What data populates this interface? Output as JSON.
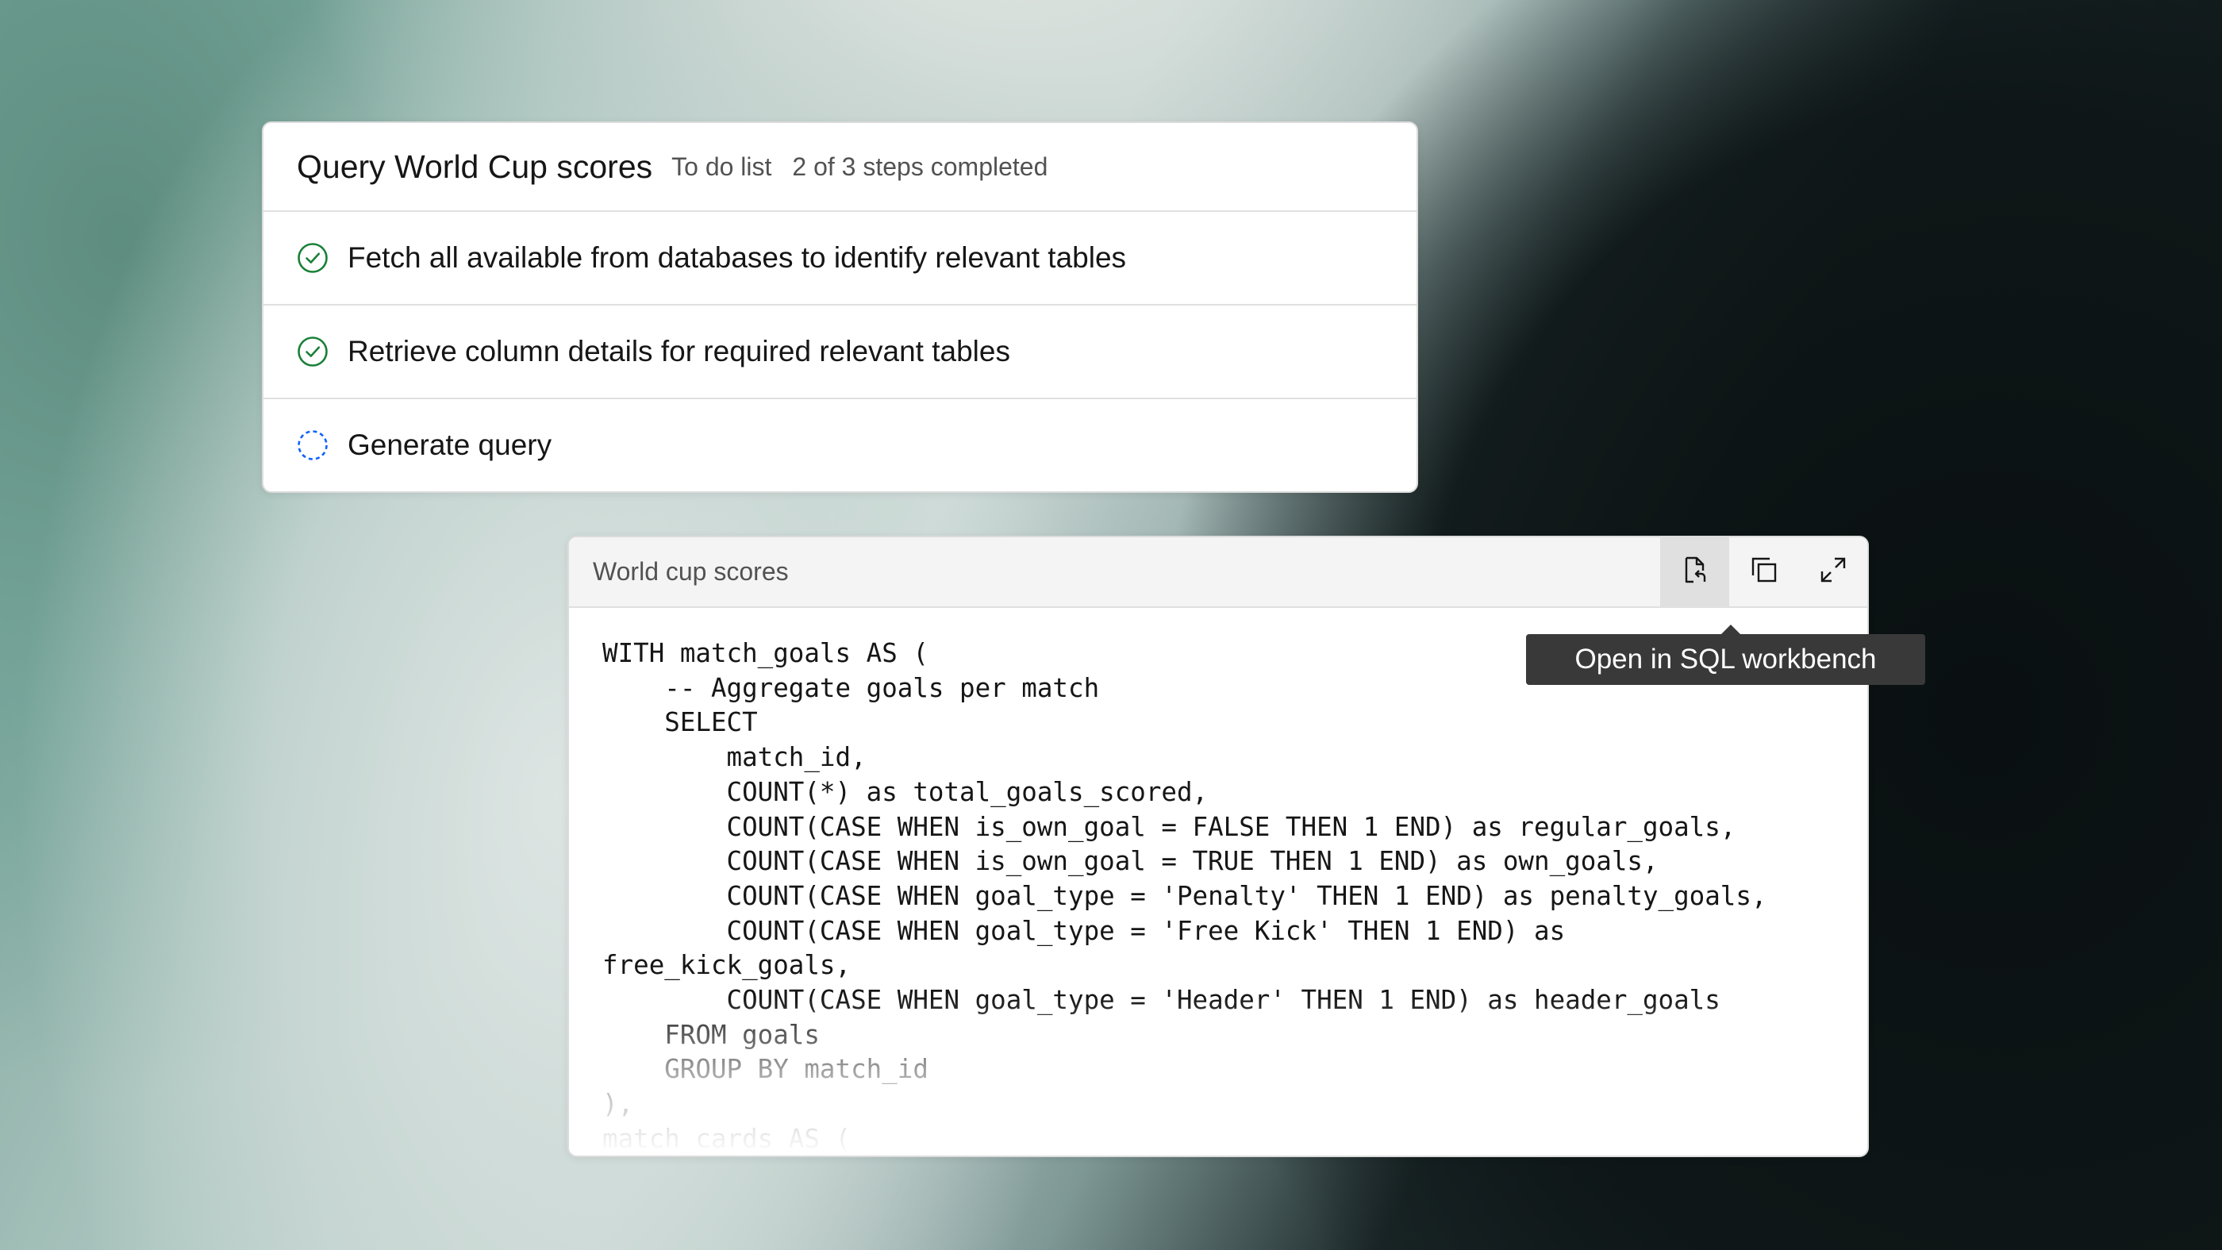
{
  "todo": {
    "title": "Query World Cup scores",
    "subtitle": "To do list",
    "progress": "2 of 3 steps completed",
    "steps": [
      {
        "label": "Fetch all available from databases to identify relevant tables",
        "status": "completed",
        "icon": "checkmark-outline-icon"
      },
      {
        "label": "Retrieve column details for required relevant tables",
        "status": "completed",
        "icon": "checkmark-outline-icon"
      },
      {
        "label": "Generate query",
        "status": "in-progress",
        "icon": "in-progress-icon"
      }
    ]
  },
  "code_snippet": {
    "title": "World cup scores",
    "toolbar": [
      {
        "icon": "open-in-workbench-icon",
        "active": true
      },
      {
        "icon": "copy-icon",
        "active": false
      },
      {
        "icon": "maximize-icon",
        "active": false
      }
    ],
    "tooltip": "Open in SQL workbench",
    "code": "WITH match_goals AS (\n    -- Aggregate goals per match\n    SELECT\n        match_id,\n        COUNT(*) as total_goals_scored,\n        COUNT(CASE WHEN is_own_goal = FALSE THEN 1 END) as regular_goals,\n        COUNT(CASE WHEN is_own_goal = TRUE THEN 1 END) as own_goals,\n        COUNT(CASE WHEN goal_type = 'Penalty' THEN 1 END) as penalty_goals,\n        COUNT(CASE WHEN goal_type = 'Free Kick' THEN 1 END) as\nfree_kick_goals,\n        COUNT(CASE WHEN goal_type = 'Header' THEN 1 END) as header_goals\n    FROM goals\n    GROUP BY match_id\n),\nmatch_cards AS ("
  },
  "colors": {
    "success": "#198038",
    "in_progress": "#0f62fe",
    "tooltip_bg": "#393939"
  }
}
